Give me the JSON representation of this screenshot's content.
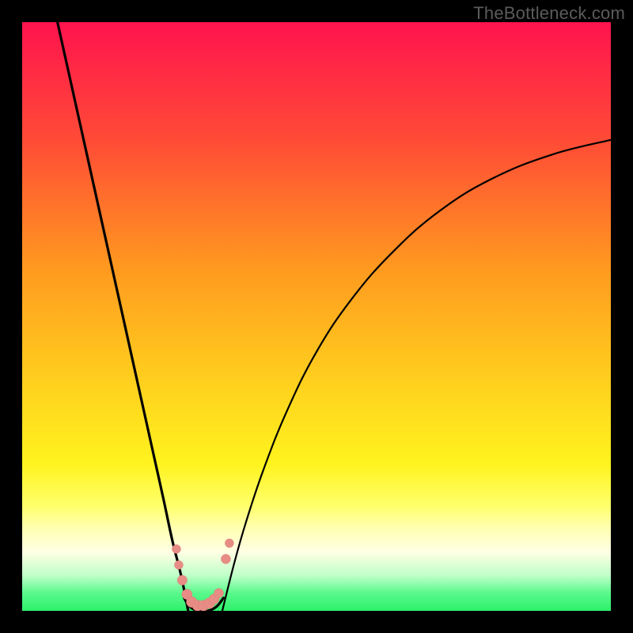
{
  "watermark": "TheBottleneck.com",
  "colors": {
    "frame": "#000000",
    "curve": "#000000",
    "marker_fill": "#e78d85",
    "marker_stroke": "#d97e76",
    "green_band": "#2df06b"
  },
  "chart_data": {
    "type": "line",
    "title": "",
    "xlabel": "",
    "ylabel": "",
    "xlim": [
      0,
      100
    ],
    "ylim": [
      0,
      100
    ],
    "gradient_stops": [
      {
        "offset": 0,
        "color": "#ff134e"
      },
      {
        "offset": 20,
        "color": "#ff4b36"
      },
      {
        "offset": 42,
        "color": "#ff9a1f"
      },
      {
        "offset": 62,
        "color": "#ffd21e"
      },
      {
        "offset": 75,
        "color": "#fff31e"
      },
      {
        "offset": 82,
        "color": "#ffff69"
      },
      {
        "offset": 86,
        "color": "#ffffb2"
      },
      {
        "offset": 90,
        "color": "#ffffe5"
      },
      {
        "offset": 94,
        "color": "#bfffc8"
      },
      {
        "offset": 97,
        "color": "#59f98c"
      },
      {
        "offset": 100,
        "color": "#2df06b"
      }
    ],
    "series": [
      {
        "name": "left-branch",
        "x": [
          6,
          8,
          10,
          12,
          14,
          16,
          18,
          20,
          22,
          24,
          25.5,
          27,
          28.2
        ],
        "y": [
          100,
          91,
          82,
          73,
          64,
          55,
          46,
          37,
          28,
          19,
          12,
          6,
          0
        ]
      },
      {
        "name": "valley-floor",
        "x": [
          27.5,
          28.5,
          30,
          31.5,
          33,
          34.2
        ],
        "y": [
          2.2,
          0.7,
          0,
          0,
          0.7,
          2.2
        ]
      },
      {
        "name": "right-branch",
        "x": [
          34,
          36,
          38,
          41,
          45,
          50,
          56,
          63,
          71,
          80,
          90,
          100
        ],
        "y": [
          0,
          8,
          15,
          24,
          34,
          44,
          53,
          61,
          68,
          73.5,
          77.5,
          80
        ]
      }
    ],
    "markers": {
      "name": "salmon-dots",
      "x": [
        26.2,
        26.6,
        27.2,
        28.0,
        28.8,
        29.8,
        30.8,
        31.8,
        32.6,
        33.4,
        34.6,
        35.2
      ],
      "y": [
        10.5,
        7.8,
        5.2,
        2.8,
        1.5,
        0.9,
        0.9,
        1.3,
        2.0,
        3.0,
        8.8,
        11.5
      ],
      "r": [
        5.5,
        5.5,
        6.2,
        6.5,
        6.8,
        6.8,
        6.8,
        6.8,
        6.5,
        6.0,
        6.0,
        5.5
      ]
    }
  }
}
